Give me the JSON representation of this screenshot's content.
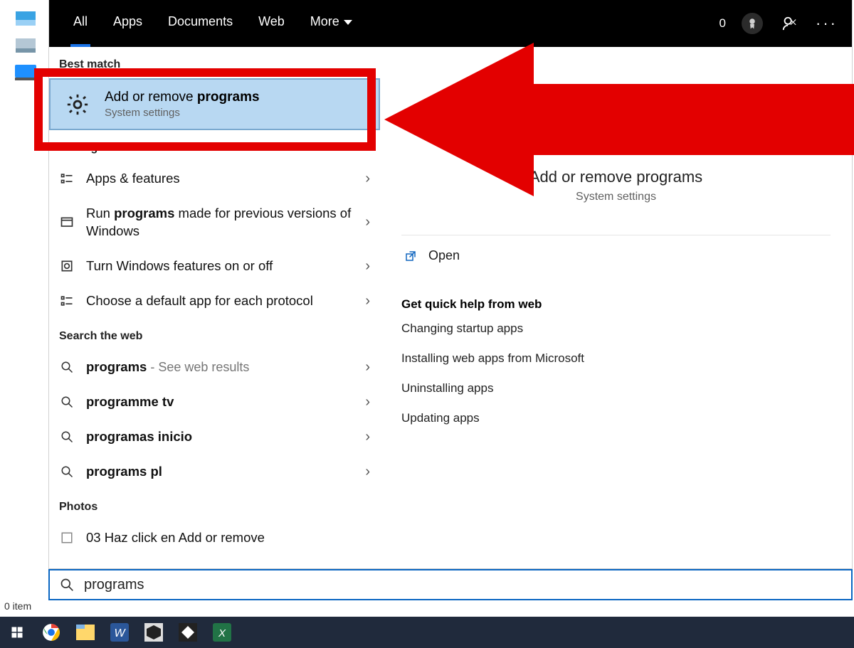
{
  "tabs": {
    "all": "All",
    "apps": "Apps",
    "documents": "Documents",
    "web": "Web",
    "more": "More"
  },
  "tabbar_right": {
    "count": "0"
  },
  "sections": {
    "best_match": "Best match",
    "settings": "Settings",
    "search_web": "Search the web",
    "photos": "Photos"
  },
  "best_match": {
    "title_pre": "Add or remove ",
    "title_bold": "programs",
    "subtitle": "System settings"
  },
  "settings_rows": [
    {
      "label": "Apps & features"
    },
    {
      "label_pre": "Run ",
      "label_bold": "programs",
      "label_post": " made for previous versions of Windows"
    },
    {
      "label": "Turn Windows features on or off"
    },
    {
      "label": "Choose a default app for each protocol"
    }
  ],
  "web_rows": [
    {
      "bold": "programs",
      "suffix": " - See web results"
    },
    {
      "bold": "programme tv"
    },
    {
      "bold": "programas inicio"
    },
    {
      "bold": "programs pl"
    }
  ],
  "photos_rows": [
    {
      "label": "03 Haz click en Add or remove"
    }
  ],
  "detail": {
    "title": "Add or remove programs",
    "subtitle": "System settings",
    "open": "Open",
    "help_head": "Get quick help from web",
    "help_items": [
      "Changing startup apps",
      "Installing web apps from Microsoft",
      "Uninstalling apps",
      "Updating apps"
    ]
  },
  "search": {
    "value": "programs"
  },
  "status": {
    "text": "0 item"
  }
}
